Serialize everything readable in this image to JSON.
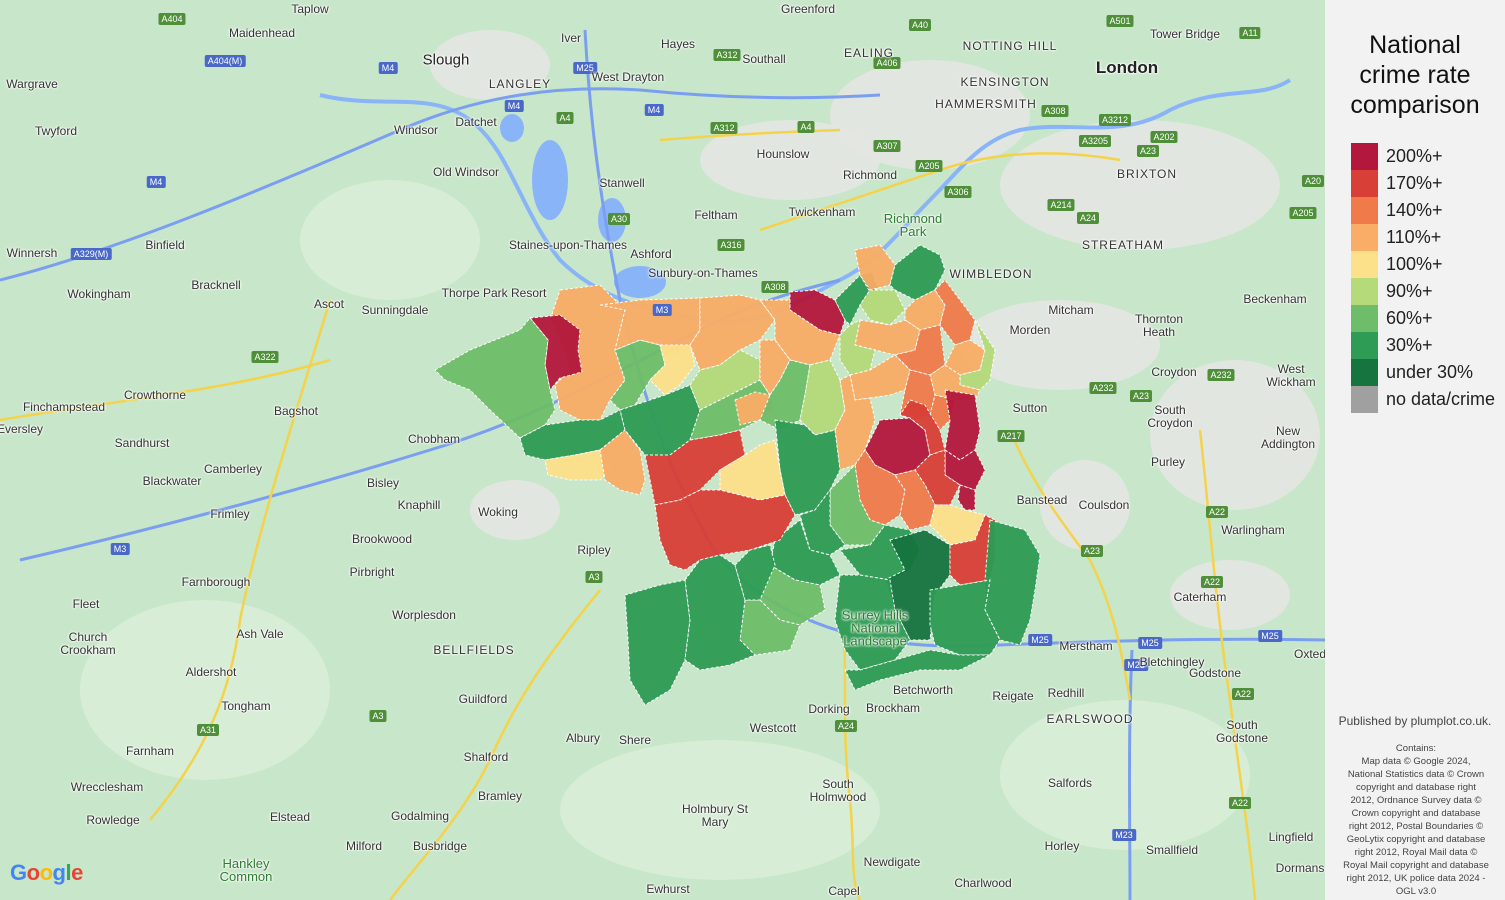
{
  "legend": {
    "title_lines": [
      "National",
      "crime rate",
      "comparison"
    ],
    "items": [
      {
        "label": "200%+",
        "color": "#b3173b"
      },
      {
        "label": "170%+",
        "color": "#d83f36"
      },
      {
        "label": "140%+",
        "color": "#f07a4a"
      },
      {
        "label": "110%+",
        "color": "#f9ad66"
      },
      {
        "label": "100%+",
        "color": "#fde08a"
      },
      {
        "label": "90%+",
        "color": "#b4da79"
      },
      {
        "label": "60%+",
        "color": "#6ebd6a"
      },
      {
        "label": "30%+",
        "color": "#2e9c55"
      },
      {
        "label": "under 30%",
        "color": "#16743f"
      },
      {
        "label": "no data/crime",
        "color": "#a0a0a0"
      }
    ]
  },
  "published": "Published by plumplot.co.uk.",
  "credits": [
    "Contains:",
    "Map data © Google 2024,",
    "National Statistics data © Crown",
    "copyright and database right",
    "2012, Ordnance Survey data ©",
    "Crown copyright and database",
    "right 2012, Postal Boundaries ©",
    "GeoLytix copyright and database",
    "right 2012, Royal Mail data ©",
    "Royal Mail copyright and database",
    "right 2012, UK police data 2024 -",
    "OGL v3.0"
  ],
  "google_logo": {
    "letters": [
      "G",
      "o",
      "o",
      "g",
      "l",
      "e"
    ],
    "colors": [
      "#4285f4",
      "#ea4335",
      "#fbbc05",
      "#4285f4",
      "#34a853",
      "#ea4335"
    ]
  },
  "places": [
    {
      "name": "Taplow",
      "style": ""
    },
    {
      "name": "Maidenhead",
      "style": ""
    },
    {
      "name": "Slough",
      "style": "mid"
    },
    {
      "name": "Iver",
      "style": ""
    },
    {
      "name": "Greenford",
      "style": ""
    },
    {
      "name": "Hayes",
      "style": ""
    },
    {
      "name": "EALING",
      "style": "caps"
    },
    {
      "name": "NOTTING HILL",
      "style": "caps"
    },
    {
      "name": "London",
      "style": "big"
    },
    {
      "name": "Tower Bridge",
      "style": ""
    },
    {
      "name": "Wargrave",
      "style": ""
    },
    {
      "name": "LANGLEY",
      "style": "caps"
    },
    {
      "name": "West Drayton",
      "style": ""
    },
    {
      "name": "Southall",
      "style": ""
    },
    {
      "name": "KENSINGTON",
      "style": "caps"
    },
    {
      "name": "HAMMERSMITH",
      "style": "caps"
    },
    {
      "name": "Twyford",
      "style": ""
    },
    {
      "name": "Windsor",
      "style": ""
    },
    {
      "name": "Datchet",
      "style": ""
    },
    {
      "name": "Hounslow",
      "style": ""
    },
    {
      "name": "BRIXTON",
      "style": "caps"
    },
    {
      "name": "Old Windsor",
      "style": ""
    },
    {
      "name": "Stanwell",
      "style": ""
    },
    {
      "name": "Richmond",
      "style": ""
    },
    {
      "name": "Feltham",
      "style": ""
    },
    {
      "name": "Twickenham",
      "style": ""
    },
    {
      "name": "Richmond Park",
      "style": "park"
    },
    {
      "name": "Binfield",
      "style": ""
    },
    {
      "name": "Staines-upon-Thames",
      "style": ""
    },
    {
      "name": "STREATHAM",
      "style": "caps"
    },
    {
      "name": "Winnersh",
      "style": ""
    },
    {
      "name": "Ashford",
      "style": ""
    },
    {
      "name": "WIMBLEDON",
      "style": "caps"
    },
    {
      "name": "Sunbury-on-Thames",
      "style": ""
    },
    {
      "name": "Bracknell",
      "style": ""
    },
    {
      "name": "Thorpe Park Resort",
      "style": ""
    },
    {
      "name": "Wokingham",
      "style": ""
    },
    {
      "name": "Ascot",
      "style": ""
    },
    {
      "name": "Beckenham",
      "style": ""
    },
    {
      "name": "Mitcham",
      "style": ""
    },
    {
      "name": "Sunningdale",
      "style": ""
    },
    {
      "name": "Morden",
      "style": ""
    },
    {
      "name": "Thornton Heath",
      "style": ""
    },
    {
      "name": "Croydon",
      "style": ""
    },
    {
      "name": "West Wickham",
      "style": ""
    },
    {
      "name": "Crowthorne",
      "style": ""
    },
    {
      "name": "Finchampstead",
      "style": ""
    },
    {
      "name": "Bagshot",
      "style": ""
    },
    {
      "name": "Sutton",
      "style": ""
    },
    {
      "name": "South Croydon",
      "style": ""
    },
    {
      "name": "Eversley",
      "style": ""
    },
    {
      "name": "Sandhurst",
      "style": ""
    },
    {
      "name": "Chobham",
      "style": ""
    },
    {
      "name": "New Addington",
      "style": ""
    },
    {
      "name": "Purley",
      "style": ""
    },
    {
      "name": "Camberley",
      "style": ""
    },
    {
      "name": "Blackwater",
      "style": ""
    },
    {
      "name": "Bisley",
      "style": ""
    },
    {
      "name": "Banstead",
      "style": ""
    },
    {
      "name": "Knaphill",
      "style": ""
    },
    {
      "name": "Woking",
      "style": ""
    },
    {
      "name": "Coulsdon",
      "style": ""
    },
    {
      "name": "Frimley",
      "style": ""
    },
    {
      "name": "Brookwood",
      "style": ""
    },
    {
      "name": "Ripley",
      "style": ""
    },
    {
      "name": "Warlingham",
      "style": ""
    },
    {
      "name": "Pirbright",
      "style": ""
    },
    {
      "name": "Farnborough",
      "style": ""
    },
    {
      "name": "Caterham",
      "style": ""
    },
    {
      "name": "Fleet",
      "style": ""
    },
    {
      "name": "Worplesdon",
      "style": ""
    },
    {
      "name": "Ash Vale",
      "style": ""
    },
    {
      "name": "Church Crookham",
      "style": ""
    },
    {
      "name": "BELLFIELDS",
      "style": "caps"
    },
    {
      "name": "Merstham",
      "style": ""
    },
    {
      "name": "Surrey Hills National Landscape",
      "style": "park"
    },
    {
      "name": "Bletchingley",
      "style": ""
    },
    {
      "name": "Godstone",
      "style": ""
    },
    {
      "name": "Oxted",
      "style": ""
    },
    {
      "name": "Aldershot",
      "style": ""
    },
    {
      "name": "Betchworth",
      "style": ""
    },
    {
      "name": "Reigate",
      "style": ""
    },
    {
      "name": "Redhill",
      "style": ""
    },
    {
      "name": "Guildford",
      "style": ""
    },
    {
      "name": "Dorking",
      "style": ""
    },
    {
      "name": "Brockham",
      "style": ""
    },
    {
      "name": "Tongham",
      "style": ""
    },
    {
      "name": "EARLSWOOD",
      "style": "caps"
    },
    {
      "name": "South Godstone",
      "style": ""
    },
    {
      "name": "Westcott",
      "style": ""
    },
    {
      "name": "Albury",
      "style": ""
    },
    {
      "name": "Shere",
      "style": ""
    },
    {
      "name": "Farnham",
      "style": ""
    },
    {
      "name": "Shalford",
      "style": ""
    },
    {
      "name": "Wrecclesham",
      "style": ""
    },
    {
      "name": "South Holmwood",
      "style": ""
    },
    {
      "name": "Salfords",
      "style": ""
    },
    {
      "name": "Bramley",
      "style": ""
    },
    {
      "name": "Rowledge",
      "style": ""
    },
    {
      "name": "Elstead",
      "style": ""
    },
    {
      "name": "Godalming",
      "style": ""
    },
    {
      "name": "Holmbury St Mary",
      "style": ""
    },
    {
      "name": "Lingfield",
      "style": ""
    },
    {
      "name": "Milford",
      "style": ""
    },
    {
      "name": "Busbridge",
      "style": ""
    },
    {
      "name": "Horley",
      "style": ""
    },
    {
      "name": "Smallfield",
      "style": ""
    },
    {
      "name": "Hankley Common",
      "style": "park"
    },
    {
      "name": "Newdigate",
      "style": ""
    },
    {
      "name": "Charlwood",
      "style": ""
    },
    {
      "name": "Ewhurst",
      "style": ""
    },
    {
      "name": "Capel",
      "style": ""
    },
    {
      "name": "Dormans",
      "style": ""
    }
  ],
  "roads": [
    {
      "label": "A404",
      "type": "aroad"
    },
    {
      "label": "A404(M)",
      "type": "motor"
    },
    {
      "label": "M4",
      "type": "motor"
    },
    {
      "label": "M25",
      "type": "motor"
    },
    {
      "label": "A312",
      "type": "aroad"
    },
    {
      "label": "A40",
      "type": "aroad"
    },
    {
      "label": "A406",
      "type": "aroad"
    },
    {
      "label": "A501",
      "type": "aroad"
    },
    {
      "label": "A11",
      "type": "aroad"
    },
    {
      "label": "A308",
      "type": "aroad"
    },
    {
      "label": "A3212",
      "type": "aroad"
    },
    {
      "label": "A3205",
      "type": "aroad"
    },
    {
      "label": "A202",
      "type": "aroad"
    },
    {
      "label": "A23",
      "type": "aroad"
    },
    {
      "label": "A307",
      "type": "aroad"
    },
    {
      "label": "A205",
      "type": "aroad"
    },
    {
      "label": "A306",
      "type": "aroad"
    },
    {
      "label": "A4",
      "type": "aroad"
    },
    {
      "label": "A30",
      "type": "aroad"
    },
    {
      "label": "A316",
      "type": "aroad"
    },
    {
      "label": "A329(M)",
      "type": "motor"
    },
    {
      "label": "A214",
      "type": "aroad"
    },
    {
      "label": "A24",
      "type": "aroad"
    },
    {
      "label": "A20",
      "type": "aroad"
    },
    {
      "label": "M3",
      "type": "motor"
    },
    {
      "label": "A322",
      "type": "aroad"
    },
    {
      "label": "A232",
      "type": "aroad"
    },
    {
      "label": "A217",
      "type": "aroad"
    },
    {
      "label": "A3",
      "type": "aroad"
    },
    {
      "label": "A22",
      "type": "aroad"
    },
    {
      "label": "M23",
      "type": "motor"
    },
    {
      "label": "A31",
      "type": "aroad"
    }
  ]
}
